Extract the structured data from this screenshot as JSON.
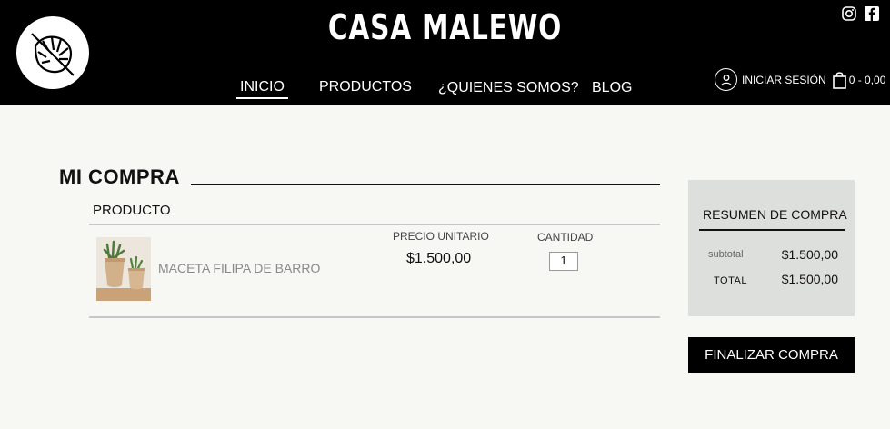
{
  "header": {
    "brand": "CASA MALEWO",
    "nav": [
      "INICIO",
      "PRODUCTOS",
      "¿QUIENES SOMOS?",
      "BLOG"
    ],
    "login_label": "INICIAR SESIÓN",
    "cart_label": "0 - 0,00",
    "social": [
      "instagram-icon",
      "facebook-icon"
    ]
  },
  "main": {
    "title": "MI COMPRA",
    "column_product": "PRODUCTO",
    "column_unit_price": "PRECIO UNITARIO",
    "column_quantity": "CANTIDAD",
    "item": {
      "name": "MACETA FILIPA DE BARRO",
      "unit_price": "$1.500,00",
      "quantity": "1"
    }
  },
  "summary": {
    "title": "RESUMEN DE COMPRA",
    "subtotal_label": "subtotal",
    "subtotal_value": "$1.500,00",
    "total_label": "TOTAL",
    "total_value": "$1.500,00"
  },
  "checkout_label": "FINALIZAR COMPRA"
}
